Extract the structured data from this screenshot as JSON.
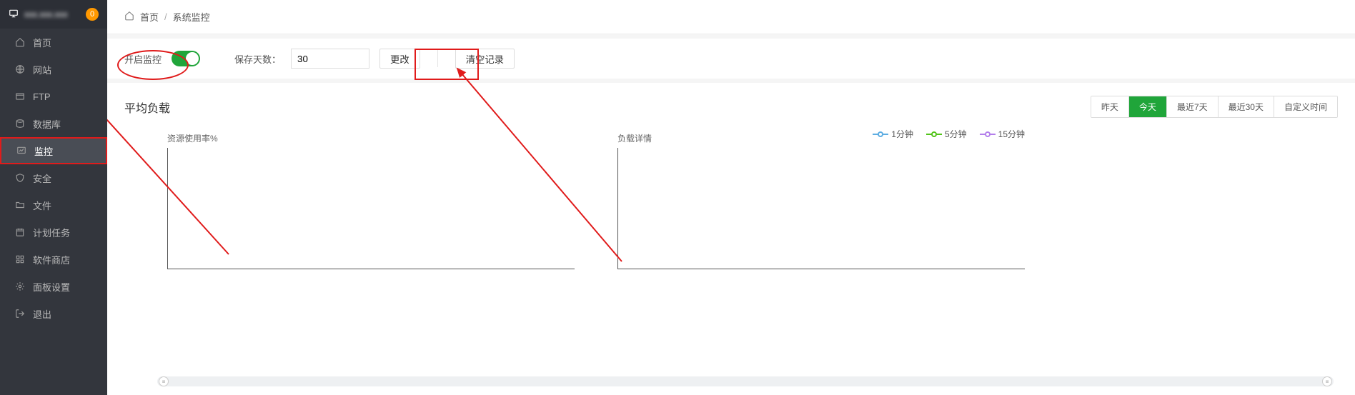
{
  "header": {
    "ip_masked": "xxx.xxx.xxx",
    "badge_count": "0"
  },
  "sidebar": {
    "items": [
      {
        "label": "首页",
        "icon": "home"
      },
      {
        "label": "网站",
        "icon": "globe"
      },
      {
        "label": "FTP",
        "icon": "ftp"
      },
      {
        "label": "数据库",
        "icon": "database"
      },
      {
        "label": "监控",
        "icon": "monitor",
        "active": true,
        "highlighted": true
      },
      {
        "label": "安全",
        "icon": "shield"
      },
      {
        "label": "文件",
        "icon": "folder"
      },
      {
        "label": "计划任务",
        "icon": "calendar"
      },
      {
        "label": "软件商店",
        "icon": "apps"
      },
      {
        "label": "面板设置",
        "icon": "gear"
      },
      {
        "label": "退出",
        "icon": "logout"
      }
    ]
  },
  "breadcrumb": {
    "home": "首页",
    "sep": "/",
    "current": "系统监控"
  },
  "toolbar": {
    "enable_label": "开启监控",
    "enabled": true,
    "keep_days_label": "保存天数：",
    "keep_days_value": "30",
    "save_btn": "更改",
    "clear_btn": "清空记录"
  },
  "section": {
    "title": "平均负载",
    "time_tabs": [
      "昨天",
      "今天",
      "最近7天",
      "最近30天",
      "自定义时间"
    ],
    "time_tab_active": 1,
    "chart1_title": "资源使用率%",
    "chart2_title": "负载详情",
    "legend": [
      {
        "label": "1分钟",
        "color": "#5dade2"
      },
      {
        "label": "5分钟",
        "color": "#52c41a"
      },
      {
        "label": "15分钟",
        "color": "#b37feb"
      }
    ]
  }
}
